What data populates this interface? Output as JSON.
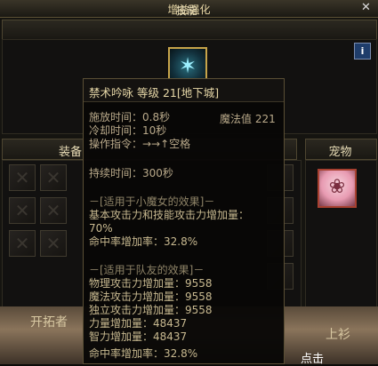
{
  "window": {
    "title": "增益强化"
  },
  "skill_section": {
    "header": "技能",
    "info_label": "i"
  },
  "equipment_section": {
    "label": "装备"
  },
  "pet_section": {
    "label": "宠物"
  },
  "background": {
    "left_text": "开拓者",
    "right_text": "上衫",
    "bottom_text": "点击"
  },
  "tooltip": {
    "skill_name": "禁术吟咏 等级 21[地下城]",
    "cast_time": "施放时间：0.8秒",
    "mp_cost": "魔法值 221",
    "cooldown": "冷却时间：10秒",
    "command": "操作指令：→→↑空格",
    "duration": "持续时间：300秒",
    "self_header": "－[适用于小魔女的效果]－",
    "self_effect_1": "基本攻击力和技能攻击力增加量：",
    "self_effect_1_value": "70%",
    "self_effect_2": "命中率增加率：32.8%",
    "party_header": "－[适用于队友的效果]－",
    "party_effects": [
      "物理攻击力增加量：9558",
      "魔法攻击力增加量：9558",
      "独立攻击力增加量：9558",
      "力量增加量：48437",
      "智力增加量：48437",
      "命中率增加率：32.8%"
    ]
  }
}
